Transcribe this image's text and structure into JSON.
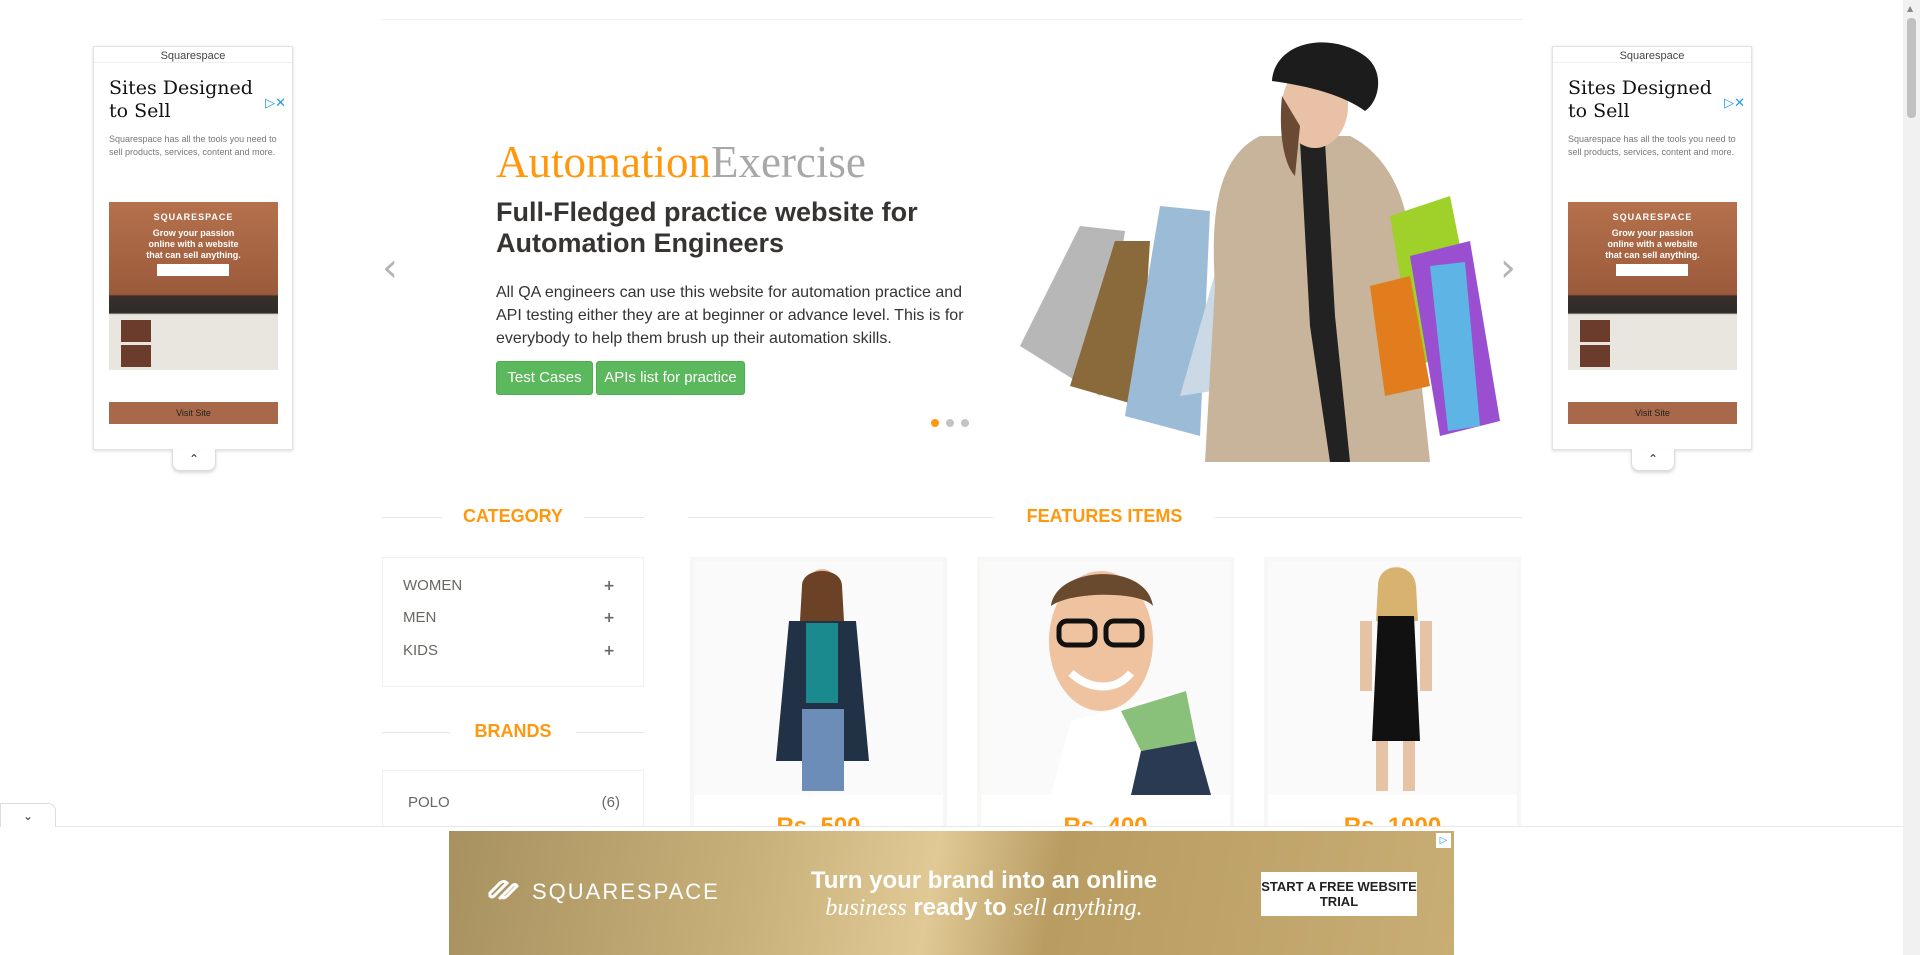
{
  "side_ad": {
    "brand": "Squarespace",
    "headline": "Sites Designed to Sell",
    "description": "Squarespace has all the tools you need to sell products, services, content and more.",
    "image_brand": "SQUARESPACE",
    "image_line1": "Grow your passion",
    "image_line2": "online with a website",
    "image_line3": "that can sell anything.",
    "visit": "Visit Site",
    "close_icon": "adchoices-close-icon"
  },
  "slider": {
    "logo_part1": "Automation",
    "logo_part2": "Exercise",
    "title": "Full-Fledged practice website for Automation Engineers",
    "description": "All QA engineers can use this website for automation practice and API testing either they are at beginner or advance level. This is for everybody to help them brush up their automation skills.",
    "btn_test_cases": "Test Cases",
    "btn_apis": "APIs list for practice",
    "active_dot": 1,
    "dot_count": 3
  },
  "category": {
    "heading": "CATEGORY",
    "items": [
      {
        "label": "WOMEN"
      },
      {
        "label": "MEN"
      },
      {
        "label": "KIDS"
      }
    ]
  },
  "brands": {
    "heading": "BRANDS",
    "items": [
      {
        "label": "POLO",
        "count": "(6)"
      }
    ]
  },
  "features": {
    "heading": "FEATURES ITEMS",
    "products": [
      {
        "price": "Rs. 500"
      },
      {
        "price": "Rs. 400"
      },
      {
        "price": "Rs. 1000"
      }
    ]
  },
  "bottom_ad": {
    "brand": "SQUARESPACE",
    "headline_line1": "Turn your brand into an online",
    "headline_line2_italic_a": "business",
    "headline_line2_mid": " ready to ",
    "headline_line2_italic_b": "sell anything.",
    "cta": "START A FREE WEBSITE TRIAL"
  },
  "colors": {
    "accent": "#fe980f",
    "button_green": "#5cb85c",
    "logo_grey": "#a8a8a8"
  }
}
